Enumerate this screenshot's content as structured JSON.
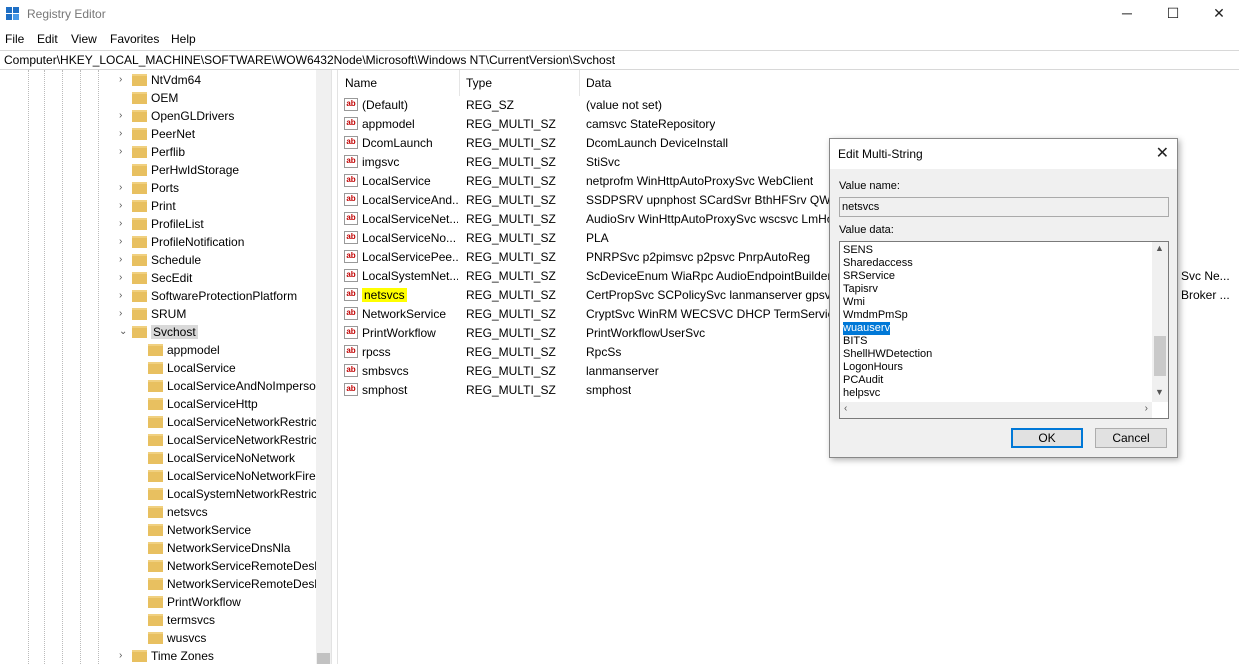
{
  "window": {
    "title": "Registry Editor",
    "minimize": "─",
    "maximize": "☐",
    "close": "✕"
  },
  "menu": [
    "File",
    "Edit",
    "View",
    "Favorites",
    "Help"
  ],
  "address": "Computer\\HKEY_LOCAL_MACHINE\\SOFTWARE\\WOW6432Node\\Microsoft\\Windows NT\\CurrentVersion\\Svchost",
  "tree": {
    "parents": [
      "NtVdm64",
      "OEM",
      "OpenGLDrivers",
      "PeerNet",
      "Perflib",
      "PerHwIdStorage",
      "Ports",
      "Print",
      "ProfileList",
      "ProfileNotification",
      "Schedule",
      "SecEdit",
      "SoftwareProtectionPlatform",
      "SRUM"
    ],
    "expanded": "Svchost",
    "children": [
      "appmodel",
      "LocalService",
      "LocalServiceAndNoImperso",
      "LocalServiceHttp",
      "LocalServiceNetworkRestrict",
      "LocalServiceNetworkRestrict",
      "LocalServiceNoNetwork",
      "LocalServiceNoNetworkFire",
      "LocalSystemNetworkRestrict",
      "netsvcs",
      "NetworkService",
      "NetworkServiceDnsNla",
      "NetworkServiceRemoteDesk",
      "NetworkServiceRemoteDesk",
      "PrintWorkflow",
      "termsvcs",
      "wusvcs"
    ],
    "after": "Time Zones"
  },
  "columns": {
    "name": "Name",
    "type": "Type",
    "data": "Data"
  },
  "values": [
    {
      "name": "(Default)",
      "type": "REG_SZ",
      "data": "(value not set)"
    },
    {
      "name": "appmodel",
      "type": "REG_MULTI_SZ",
      "data": "camsvc StateRepository"
    },
    {
      "name": "DcomLaunch",
      "type": "REG_MULTI_SZ",
      "data": "DcomLaunch DeviceInstall"
    },
    {
      "name": "imgsvc",
      "type": "REG_MULTI_SZ",
      "data": "StiSvc"
    },
    {
      "name": "LocalService",
      "type": "REG_MULTI_SZ",
      "data": "netprofm WinHttpAutoProxySvc WebClient"
    },
    {
      "name": "LocalServiceAnd...",
      "type": "REG_MULTI_SZ",
      "data": "SSDPSRV upnphost SCardSvr BthHFSrv QWAVE"
    },
    {
      "name": "LocalServiceNet...",
      "type": "REG_MULTI_SZ",
      "data": "AudioSrv WinHttpAutoProxySvc wscsvc LmHo"
    },
    {
      "name": "LocalServiceNo...",
      "type": "REG_MULTI_SZ",
      "data": "PLA"
    },
    {
      "name": "LocalServicePee...",
      "type": "REG_MULTI_SZ",
      "data": "PNRPSvc p2pimsvc p2psvc PnrpAutoReg"
    },
    {
      "name": "LocalSystemNet...",
      "type": "REG_MULTI_SZ",
      "data": "ScDeviceEnum WiaRpc AudioEndpointBuilder",
      "tail": "Svc Ne..."
    },
    {
      "name": "netsvcs",
      "type": "REG_MULTI_SZ",
      "data": "CertPropSvc SCPolicySvc lanmanserver gpsvc",
      "tail": "Broker ..."
    },
    {
      "name": "NetworkService",
      "type": "REG_MULTI_SZ",
      "data": "CryptSvc WinRM WECSVC DHCP TermService"
    },
    {
      "name": "PrintWorkflow",
      "type": "REG_MULTI_SZ",
      "data": "PrintWorkflowUserSvc"
    },
    {
      "name": "rpcss",
      "type": "REG_MULTI_SZ",
      "data": "RpcSs"
    },
    {
      "name": "smbsvcs",
      "type": "REG_MULTI_SZ",
      "data": "lanmanserver"
    },
    {
      "name": "smphost",
      "type": "REG_MULTI_SZ",
      "data": "smphost"
    }
  ],
  "value_icon": "ab",
  "dialog": {
    "title": "Edit Multi-String",
    "close": "✕",
    "value_name_label": "Value name:",
    "value_name": "netsvcs",
    "value_data_label": "Value data:",
    "lines": [
      "SENS",
      "Sharedaccess",
      "SRService",
      "Tapisrv",
      "Wmi",
      "WmdmPmSp",
      "wuauserv",
      "BITS",
      "ShellHWDetection",
      "LogonHours",
      "PCAudit",
      "helpsvc"
    ],
    "selected_line": "wuauserv",
    "ok": "OK",
    "cancel": "Cancel"
  },
  "colors": {
    "highlight": "#ffff00",
    "selection": "#0078d7",
    "folder": "#e8c060"
  }
}
